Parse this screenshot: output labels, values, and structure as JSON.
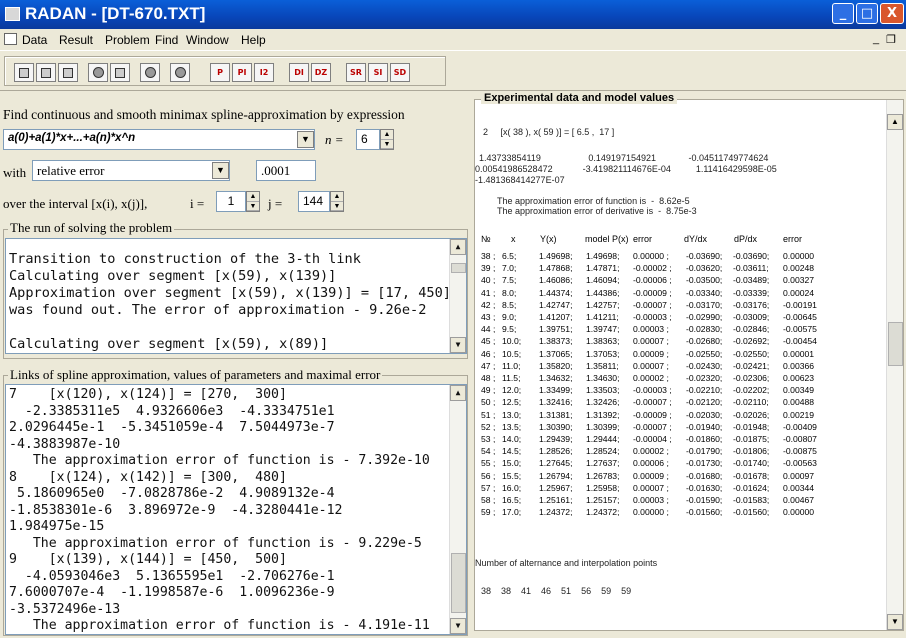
{
  "window": {
    "title": "RADAN - [DT-670.TXT]",
    "btn_min": "_",
    "btn_max": "□",
    "btn_close": "X"
  },
  "menu": {
    "items": [
      "Data",
      "Result",
      "Problem",
      "Find",
      "Window",
      "Help"
    ],
    "mdi_min": "_",
    "mdi_restore": "❐"
  },
  "toolbar": {
    "text_buttons": [
      "P",
      "PI",
      "I2",
      "DI",
      "DZ",
      "SR",
      "SI",
      "SD"
    ]
  },
  "form": {
    "heading": "Find continuous and smooth minimax spline-approximation by expression",
    "expression": "a(0)+a(1)*x+...+a(n)*x^n",
    "n_label": "n =",
    "n_value": "6",
    "with_label": "with",
    "error_type": "relative error",
    "error_value": ".0001",
    "interval_label": "over the interval [x(i), x(j)],",
    "i_label": "i =",
    "i_value": "1",
    "j_label": "j =",
    "j_value": "144"
  },
  "run_box": {
    "title": "The run of solving the problem",
    "lines": [
      "Transition to construction of the 3-th link",
      "Calculating over segment [x(59), x(139)]",
      "Approximation over segment [x(59), x(139)] = [17, 450]",
      "was found out. The error of approximation - 9.26e-2",
      "",
      "Calculating over segment [x(59), x(89)]"
    ]
  },
  "links_box": {
    "title": "Links of spline approximation, values of parameters and maximal error",
    "lines": [
      "7    [x(120), x(124)] = [270,  300]",
      "  -2.3385311e5  4.9326606e3  -4.3334751e1",
      "2.0296445e-1  -5.3451059e-4  7.5044973e-7",
      "-4.3883987e-10",
      "   The approximation error of function is - 7.392e-10",
      "8    [x(124), x(142)] = [300,  480]",
      " 5.1860965e0  -7.0828786e-2  4.9089132e-4",
      "-1.8538301e-6  3.896972e-9  -4.3280441e-12",
      "1.984975e-15",
      "   The approximation error of function is - 9.229e-5",
      "9    [x(139), x(144)] = [450,  500]",
      "  -4.0593046e3  5.1365595e1  -2.706276e-1",
      "7.6000707e-4  -1.1998587e-6  1.0096236e-9",
      "-3.5372496e-13",
      "   The approximation error of function is - 4.191e-11"
    ]
  },
  "exp_panel": {
    "title": "Experimental data and model values",
    "seg_line": "2     [x( 38 ), x( 59 )] = [ 6.5 ,  17 ]",
    "coef_line1": "1.43733854119                   0.149197154921             -0.04511749774624",
    "coef_line2": "0.00541986528472            -3.419821114676E-04          1.11416429598E-05",
    "coef_line3": "-1.481368414277E-07",
    "err_fn": "The approximation error of function is  -  8.62e-5",
    "err_der": "The approximation error of derivative is  -  8.75e-3",
    "headers": [
      "№",
      "x",
      "Y(x)",
      "model P(x)",
      "error",
      "dY/dx",
      "dP/dx",
      "error"
    ],
    "rows": [
      [
        "38 ;",
        "6.5;",
        "1.49698;",
        "1.49698;",
        "0.00000 ;",
        "-0.03690;",
        "-0.03690;",
        "0.00000"
      ],
      [
        "39 ;",
        "7.0;",
        "1.47868;",
        "1.47871;",
        "-0.00002 ;",
        "-0.03620;",
        "-0.03611;",
        "0.00248"
      ],
      [
        "40 ;",
        "7.5;",
        "1.46086;",
        "1.46094;",
        "-0.00006 ;",
        "-0.03500;",
        "-0.03489;",
        "0.00327"
      ],
      [
        "41 ;",
        "8.0;",
        "1.44374;",
        "1.44386;",
        "-0.00009 ;",
        "-0.03340;",
        "-0.03339;",
        "0.00024"
      ],
      [
        "42 ;",
        "8.5;",
        "1.42747;",
        "1.42757;",
        "-0.00007 ;",
        "-0.03170;",
        "-0.03176;",
        "-0.00191"
      ],
      [
        "43 ;",
        "9.0;",
        "1.41207;",
        "1.41211;",
        "-0.00003 ;",
        "-0.02990;",
        "-0.03009;",
        "-0.00645"
      ],
      [
        "44 ;",
        "9.5;",
        "1.39751;",
        "1.39747;",
        "0.00003 ;",
        "-0.02830;",
        "-0.02846;",
        "-0.00575"
      ],
      [
        "45 ;",
        "10.0;",
        "1.38373;",
        "1.38363;",
        "0.00007 ;",
        "-0.02680;",
        "-0.02692;",
        "-0.00454"
      ],
      [
        "46 ;",
        "10.5;",
        "1.37065;",
        "1.37053;",
        "0.00009 ;",
        "-0.02550;",
        "-0.02550;",
        "0.00001"
      ],
      [
        "47 ;",
        "11.0;",
        "1.35820;",
        "1.35811;",
        "0.00007 ;",
        "-0.02430;",
        "-0.02421;",
        "0.00366"
      ],
      [
        "48 ;",
        "11.5;",
        "1.34632;",
        "1.34630;",
        "0.00002 ;",
        "-0.02320;",
        "-0.02306;",
        "0.00623"
      ],
      [
        "49 ;",
        "12.0;",
        "1.33499;",
        "1.33503;",
        "-0.00003 ;",
        "-0.02210;",
        "-0.02202;",
        "0.00349"
      ],
      [
        "50 ;",
        "12.5;",
        "1.32416;",
        "1.32426;",
        "-0.00007 ;",
        "-0.02120;",
        "-0.02110;",
        "0.00488"
      ],
      [
        "51 ;",
        "13.0;",
        "1.31381;",
        "1.31392;",
        "-0.00009 ;",
        "-0.02030;",
        "-0.02026;",
        "0.00219"
      ],
      [
        "52 ;",
        "13.5;",
        "1.30390;",
        "1.30399;",
        "-0.00007 ;",
        "-0.01940;",
        "-0.01948;",
        "-0.00409"
      ],
      [
        "53 ;",
        "14.0;",
        "1.29439;",
        "1.29444;",
        "-0.00004 ;",
        "-0.01860;",
        "-0.01875;",
        "-0.00807"
      ],
      [
        "54 ;",
        "14.5;",
        "1.28526;",
        "1.28524;",
        "0.00002 ;",
        "-0.01790;",
        "-0.01806;",
        "-0.00875"
      ],
      [
        "55 ;",
        "15.0;",
        "1.27645;",
        "1.27637;",
        "0.00006 ;",
        "-0.01730;",
        "-0.01740;",
        "-0.00563"
      ],
      [
        "56 ;",
        "15.5;",
        "1.26794;",
        "1.26783;",
        "0.00009 ;",
        "-0.01680;",
        "-0.01678;",
        "0.00097"
      ],
      [
        "57 ;",
        "16.0;",
        "1.25967;",
        "1.25958;",
        "0.00007 ;",
        "-0.01630;",
        "-0.01624;",
        "0.00344"
      ],
      [
        "58 ;",
        "16.5;",
        "1.25161;",
        "1.25157;",
        "0.00003 ;",
        "-0.01590;",
        "-0.01583;",
        "0.00467"
      ],
      [
        "59 ;",
        "17.0;",
        "1.24372;",
        "1.24372;",
        "0.00000 ;",
        "-0.01560;",
        "-0.01560;",
        "0.00000"
      ]
    ],
    "alternance_label": "Number of alternance and interpolation points",
    "alternance_points": "38    38    41    46    51    56    59    59"
  }
}
